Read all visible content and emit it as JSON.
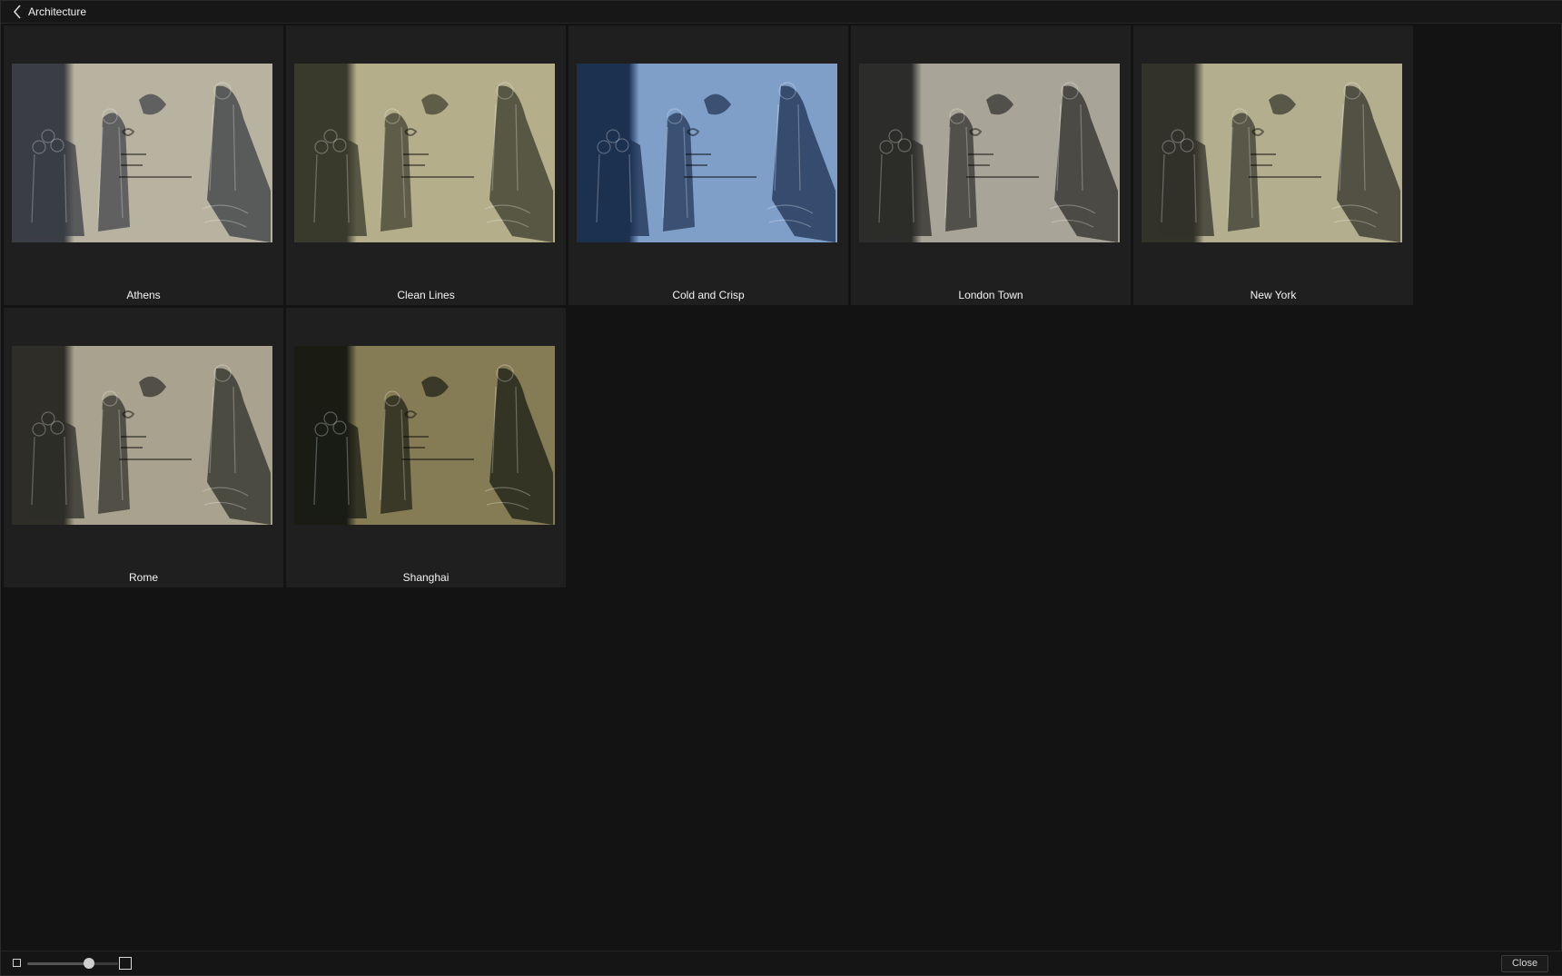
{
  "header": {
    "back_icon": "chevron-left-icon",
    "title": "Architecture"
  },
  "presets": [
    {
      "label": "Athens",
      "tint": "#b8b2a0",
      "shadow": "#3a3d44"
    },
    {
      "label": "Clean Lines",
      "tint": "#b4ae8a",
      "shadow": "#3a3a2c"
    },
    {
      "label": "Cold and Crisp",
      "tint": "#7f9fc8",
      "shadow": "#1c3050"
    },
    {
      "label": "London Town",
      "tint": "#a8a498",
      "shadow": "#2c2c2a"
    },
    {
      "label": "New York",
      "tint": "#b2ae8e",
      "shadow": "#33322a"
    },
    {
      "label": "Rome",
      "tint": "#a8a28e",
      "shadow": "#2e2d28"
    },
    {
      "label": "Shanghai",
      "tint": "#857c55",
      "shadow": "#1a1c14"
    }
  ],
  "footer": {
    "thumb_size_slider": 0.68,
    "small_icon": "small-square-icon",
    "large_icon": "large-square-icon",
    "close_label": "Close"
  }
}
